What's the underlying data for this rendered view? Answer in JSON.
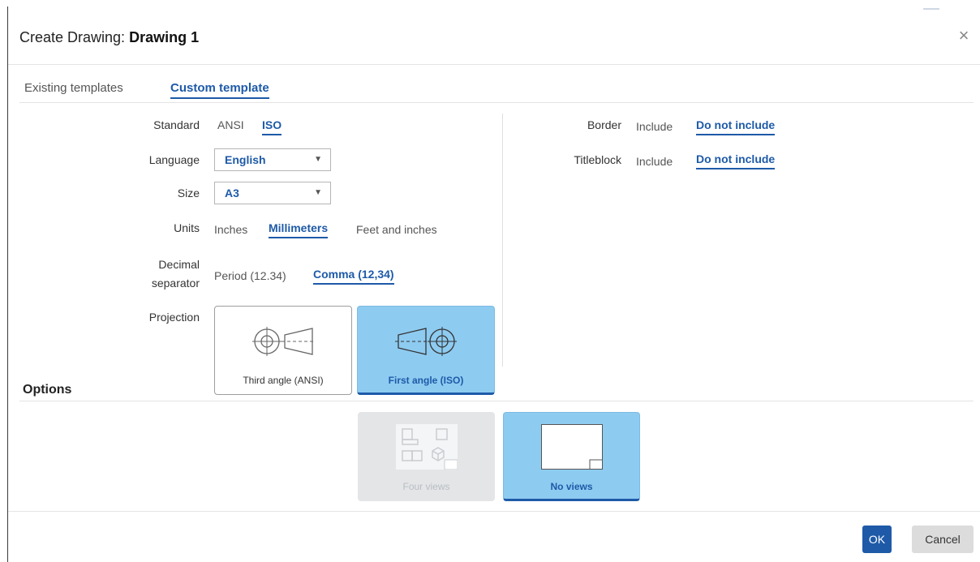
{
  "dialog": {
    "title_prefix": "Create Drawing:",
    "title_name": "Drawing 1",
    "close_glyph": "×"
  },
  "tabs": [
    {
      "label": "Existing templates",
      "active": false
    },
    {
      "label": "Custom template",
      "active": true
    }
  ],
  "form": {
    "standard": {
      "label": "Standard",
      "options": [
        "ANSI",
        "ISO"
      ],
      "selected": "ISO"
    },
    "language": {
      "label": "Language",
      "value": "English"
    },
    "size": {
      "label": "Size",
      "value": "A3"
    },
    "units": {
      "label": "Units",
      "options": [
        "Inches",
        "Millimeters",
        "Feet and inches"
      ],
      "selected": "Millimeters"
    },
    "decimal_separator": {
      "label_line1": "Decimal",
      "label_line2": "separator",
      "options": [
        "Period (12.34)",
        "Comma (12,34)"
      ],
      "selected": "Comma (12,34)"
    },
    "projection": {
      "label": "Projection",
      "cards": [
        {
          "label": "Third angle (ANSI)",
          "icon": "third-angle-projection-icon",
          "selected": false
        },
        {
          "label": "First angle (ISO)",
          "icon": "first-angle-projection-icon",
          "selected": true
        }
      ]
    },
    "border": {
      "label": "Border",
      "options": [
        "Include",
        "Do not include"
      ],
      "selected": "Do not include"
    },
    "titleblock": {
      "label": "Titleblock",
      "options": [
        "Include",
        "Do not include"
      ],
      "selected": "Do not include"
    }
  },
  "options": {
    "heading": "Options",
    "cards": [
      {
        "label": "Four views",
        "icon": "four-views-icon",
        "state": "disabled"
      },
      {
        "label": "No views",
        "icon": "no-views-icon",
        "state": "selected"
      }
    ]
  },
  "footer": {
    "ok_label": "OK",
    "cancel_label": "Cancel"
  },
  "colors": {
    "accent": "#1e5aa8",
    "selected_card": "#8ecbf0",
    "disabled_card": "#e3e5e7"
  }
}
